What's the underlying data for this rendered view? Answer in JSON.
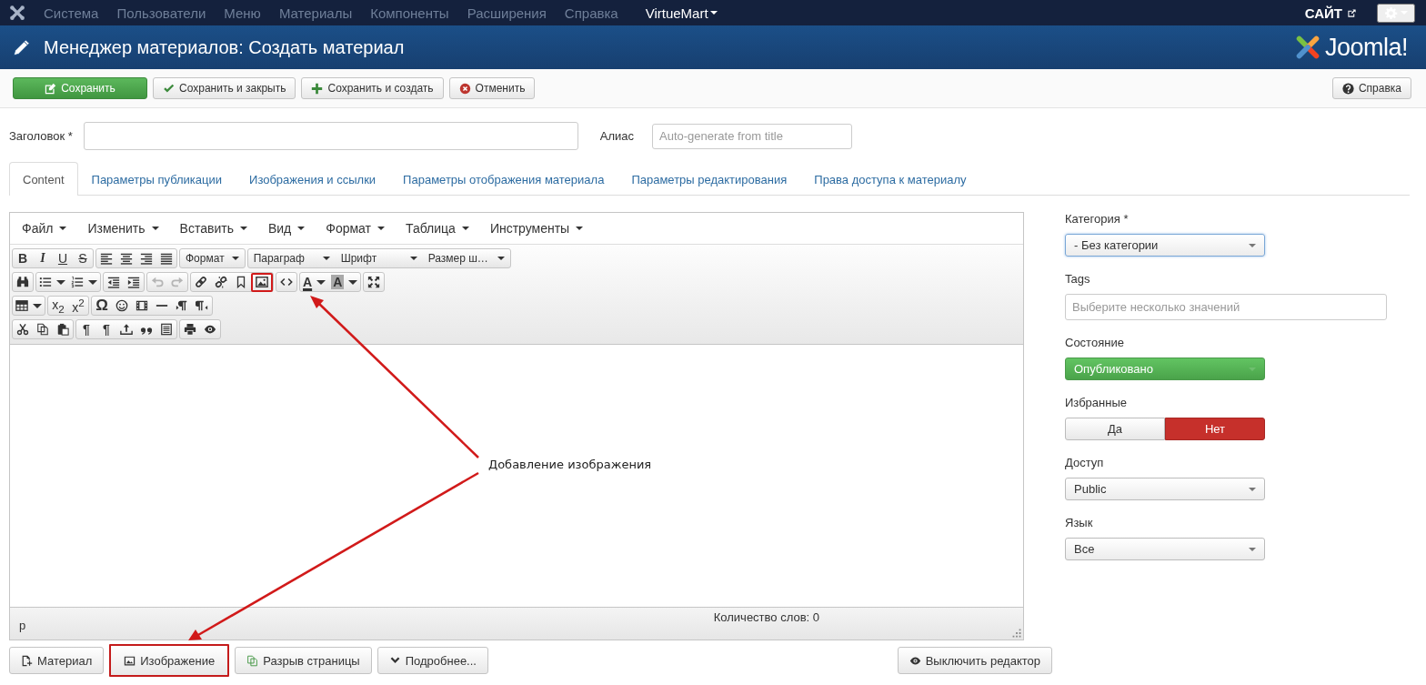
{
  "top_nav": {
    "items": [
      {
        "label": "Система",
        "dropdown": false
      },
      {
        "label": "Пользователи",
        "dropdown": false
      },
      {
        "label": "Меню",
        "dropdown": false
      },
      {
        "label": "Материалы",
        "dropdown": false
      },
      {
        "label": "Компоненты",
        "dropdown": false
      },
      {
        "label": "Расширения",
        "dropdown": false
      },
      {
        "label": "Справка",
        "dropdown": false
      },
      {
        "label": "VirtueMart",
        "dropdown": true
      }
    ],
    "site_link": "САЙТ"
  },
  "header": {
    "title": "Менеджер материалов: Создать материал",
    "logo_text": "Joomla!"
  },
  "actions": [
    {
      "label": "Сохранить",
      "kind": "primary"
    },
    {
      "label": "Сохранить и закрыть",
      "kind": "check"
    },
    {
      "label": "Сохранить и создать",
      "kind": "plus"
    },
    {
      "label": "Отменить",
      "kind": "cancel"
    }
  ],
  "help_button": "Справка",
  "title_field": {
    "label": "Заголовок *"
  },
  "alias_field": {
    "label": "Алиас",
    "placeholder": "Auto-generate from title"
  },
  "tabs": [
    {
      "label": "Content",
      "selected": true
    },
    {
      "label": "Параметры публикации",
      "selected": false
    },
    {
      "label": "Изображения и ссылки",
      "selected": false
    },
    {
      "label": "Параметры отображения материала",
      "selected": false
    },
    {
      "label": "Параметры редактирования",
      "selected": false
    },
    {
      "label": "Права доступа к материалу",
      "selected": false
    }
  ],
  "editor": {
    "menus": [
      "Файл",
      "Изменить",
      "Вставить",
      "Вид",
      "Формат",
      "Таблица",
      "Инструменты"
    ],
    "toolbar_rows": [
      [
        [
          {
            "kind": "text",
            "label": "B",
            "dropdown": false,
            "disabled": false,
            "highlighted": false
          },
          {
            "kind": "text",
            "label": "I",
            "dropdown": false,
            "disabled": false,
            "highlighted": false
          },
          {
            "kind": "text",
            "label": "U",
            "dropdown": false,
            "disabled": false,
            "highlighted": false
          },
          {
            "kind": "text",
            "label": "S",
            "dropdown": false,
            "disabled": false,
            "highlighted": false
          }
        ],
        [
          {
            "kind": "icon",
            "dropdown": false,
            "disabled": false,
            "highlighted": false
          },
          {
            "kind": "icon",
            "dropdown": false,
            "disabled": false,
            "highlighted": false
          },
          {
            "kind": "icon",
            "dropdown": false,
            "disabled": false,
            "highlighted": false
          },
          {
            "kind": "icon",
            "dropdown": false,
            "disabled": false,
            "highlighted": false
          }
        ],
        [
          {
            "kind": "select",
            "label": "Формат"
          }
        ],
        [
          {
            "kind": "select",
            "label": "Параграф"
          },
          {
            "kind": "select",
            "label": "Шрифт"
          },
          {
            "kind": "select",
            "label": "Размер ш…"
          }
        ]
      ],
      [
        [
          {
            "kind": "icon",
            "dropdown": false,
            "disabled": false,
            "highlighted": false
          }
        ],
        [
          {
            "kind": "icon",
            "dropdown": true,
            "disabled": false,
            "highlighted": false
          },
          {
            "kind": "icon",
            "dropdown": true,
            "disabled": false,
            "highlighted": false
          }
        ],
        [
          {
            "kind": "icon",
            "dropdown": false,
            "disabled": false,
            "highlighted": false
          },
          {
            "kind": "icon",
            "dropdown": false,
            "disabled": false,
            "highlighted": false
          }
        ],
        [
          {
            "kind": "icon",
            "dropdown": false,
            "disabled": true,
            "highlighted": false
          },
          {
            "kind": "icon",
            "dropdown": false,
            "disabled": true,
            "highlighted": false
          }
        ],
        [
          {
            "kind": "icon",
            "dropdown": false,
            "disabled": false,
            "highlighted": false
          },
          {
            "kind": "icon",
            "dropdown": false,
            "disabled": false,
            "highlighted": false
          },
          {
            "kind": "icon",
            "dropdown": false,
            "disabled": false,
            "highlighted": false
          },
          {
            "kind": "icon",
            "dropdown": false,
            "disabled": false,
            "highlighted": true
          }
        ],
        [
          {
            "kind": "icon",
            "dropdown": false,
            "disabled": false,
            "highlighted": false
          }
        ],
        [
          {
            "kind": "text",
            "label": "A",
            "dropdown": true,
            "disabled": false,
            "highlighted": false
          },
          {
            "kind": "text",
            "label": "A",
            "dropdown": true,
            "disabled": false,
            "highlighted": false
          }
        ],
        [
          {
            "kind": "icon",
            "dropdown": false,
            "disabled": false,
            "highlighted": false
          }
        ]
      ],
      [
        [
          {
            "kind": "icon",
            "dropdown": true,
            "disabled": false,
            "highlighted": false
          }
        ],
        [
          {
            "kind": "text",
            "label": "x$_{2}$",
            "dropdown": false,
            "disabled": false,
            "highlighted": false
          },
          {
            "kind": "text",
            "label": "x$^{2}$",
            "dropdown": false,
            "disabled": false,
            "highlighted": false
          }
        ],
        [
          {
            "kind": "text",
            "label": "Ω",
            "dropdown": false,
            "disabled": false,
            "highlighted": false
          },
          {
            "kind": "icon",
            "dropdown": false,
            "disabled": false,
            "highlighted": false
          },
          {
            "kind": "icon",
            "dropdown": false,
            "disabled": false,
            "highlighted": false
          },
          {
            "kind": "icon",
            "dropdown": false,
            "disabled": false,
            "highlighted": false
          },
          {
            "kind": "icon",
            "dropdown": false,
            "disabled": false,
            "highlighted": false
          },
          {
            "kind": "icon",
            "dropdown": false,
            "disabled": false,
            "highlighted": false
          }
        ]
      ],
      [
        [
          {
            "kind": "icon",
            "dropdown": false,
            "disabled": false,
            "highlighted": false
          },
          {
            "kind": "icon",
            "dropdown": false,
            "disabled": false,
            "highlighted": false
          },
          {
            "kind": "icon",
            "dropdown": false,
            "disabled": false,
            "highlighted": false
          }
        ],
        [
          {
            "kind": "text",
            "label": "¶",
            "dropdown": false,
            "disabled": false,
            "highlighted": false
          },
          {
            "kind": "text",
            "label": "¶",
            "dropdown": false,
            "disabled": false,
            "highlighted": false
          },
          {
            "kind": "icon",
            "dropdown": false,
            "disabled": false,
            "highlighted": false
          },
          {
            "kind": "icon",
            "dropdown": false,
            "disabled": false,
            "highlighted": false
          },
          {
            "kind": "icon",
            "dropdown": false,
            "disabled": false,
            "highlighted": false
          }
        ],
        [
          {
            "kind": "icon",
            "dropdown": false,
            "disabled": false,
            "highlighted": false
          },
          {
            "kind": "icon",
            "dropdown": false,
            "disabled": false,
            "highlighted": false
          }
        ]
      ]
    ],
    "path": "p",
    "word_count": "Количество слов: 0"
  },
  "editor_buttons": [
    {
      "label": "Материал",
      "highlighted": false
    },
    {
      "label": "Изображение",
      "highlighted": true
    },
    {
      "label": "Разрыв страницы",
      "highlighted": false
    },
    {
      "label": "Подробнее...",
      "highlighted": false
    }
  ],
  "toggle_editor": "Выключить редактор",
  "annotation": "Добавление изображения",
  "sidebar": {
    "fields": [
      {
        "kind": "select",
        "label": "Категория *",
        "value": "- Без категории",
        "focused": true
      },
      {
        "kind": "input",
        "label": "Tags",
        "placeholder": "Выберите несколько значений"
      },
      {
        "kind": "status",
        "label": "Состояние",
        "value": "Опубликовано"
      },
      {
        "kind": "toggle",
        "label": "Избранные",
        "options": [
          {
            "label": "Да",
            "selected": false
          },
          {
            "label": "Нет",
            "selected": true
          }
        ]
      },
      {
        "kind": "select",
        "label": "Доступ",
        "value": "Public",
        "focused": false
      },
      {
        "kind": "select",
        "label": "Язык",
        "value": "Все",
        "focused": false
      }
    ]
  }
}
